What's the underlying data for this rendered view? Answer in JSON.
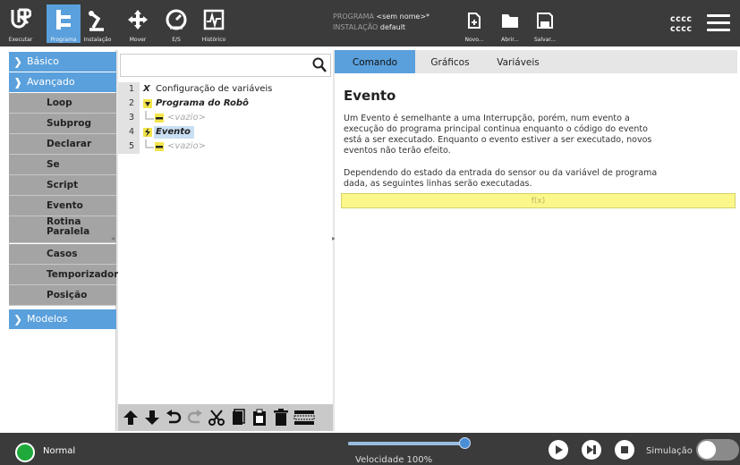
{
  "topbar": {
    "nav": [
      {
        "label": "Executar",
        "icon": "ur-logo-icon"
      },
      {
        "label": "Programa",
        "icon": "program-tree-icon"
      },
      {
        "label": "Instalação",
        "icon": "robot-arm-icon"
      },
      {
        "label": "Mover",
        "icon": "move-arrows-icon"
      },
      {
        "label": "E/S",
        "icon": "io-gauge-icon"
      },
      {
        "label": "Histórico",
        "icon": "log-chart-icon"
      }
    ],
    "program_label": "PROGRAMA",
    "program_value": "<sem nome>*",
    "install_label": "INSTALAÇÃO",
    "install_value": "default",
    "file_buttons": [
      {
        "label": "Novo...",
        "icon": "new-file-icon"
      },
      {
        "label": "Abrir...",
        "icon": "open-folder-icon"
      },
      {
        "label": "Salvar...",
        "icon": "save-icon"
      }
    ],
    "user_line1": "cccc",
    "user_line2": "cccc"
  },
  "sidebar": {
    "basico": "Básico",
    "avancado": "Avançado",
    "items": [
      "Loop",
      "Subprog",
      "Declarar",
      "Se",
      "Script",
      "Evento",
      "Rotina\nParalela",
      "Casos",
      "Temporizador",
      "Posição Inicial"
    ],
    "modelos": "Modelos"
  },
  "search": {
    "placeholder": "",
    "value": ""
  },
  "tree": [
    {
      "num": "1",
      "text": "Configuração de variáveis",
      "style": "normal",
      "icon": "variable-x-icon"
    },
    {
      "num": "2",
      "text": "Programa do Robô",
      "style": "bold-italic",
      "icon": "collapse-triangle-icon"
    },
    {
      "num": "3",
      "text": "<vazio>",
      "style": "empty",
      "icon": "empty-node-icon"
    },
    {
      "num": "4",
      "text": "Evento",
      "style": "selected",
      "icon": "lightning-icon"
    },
    {
      "num": "5",
      "text": "<vazio>",
      "style": "empty",
      "icon": "empty-node-icon"
    }
  ],
  "tabs": {
    "comando": "Comando",
    "graficos": "Gráficos",
    "variaveis": "Variáveis"
  },
  "command": {
    "title": "Evento",
    "desc1": "Um Evento é semelhante a uma Interrupção, porém, num evento a execução do programa principal continua enquanto o código do evento está a ser executado. Enquanto o evento estiver a ser executado, novos eventos não terão efeito.",
    "desc2": "Dependendo do estado da entrada do sensor ou da variável de programa dada, as seguintes linhas serão executadas.",
    "expression": "f(x)"
  },
  "bottom": {
    "status": "Normal",
    "speed_label": "Velocidade 100%",
    "speed_fraction": 1.0,
    "sim_label": "Simulação",
    "simulation_on": false
  },
  "colors": {
    "accent": "#5aa0dc",
    "topbar": "#3b3b3b",
    "status_green": "#1fa93b",
    "expression_yellow": "#fcf78a"
  }
}
